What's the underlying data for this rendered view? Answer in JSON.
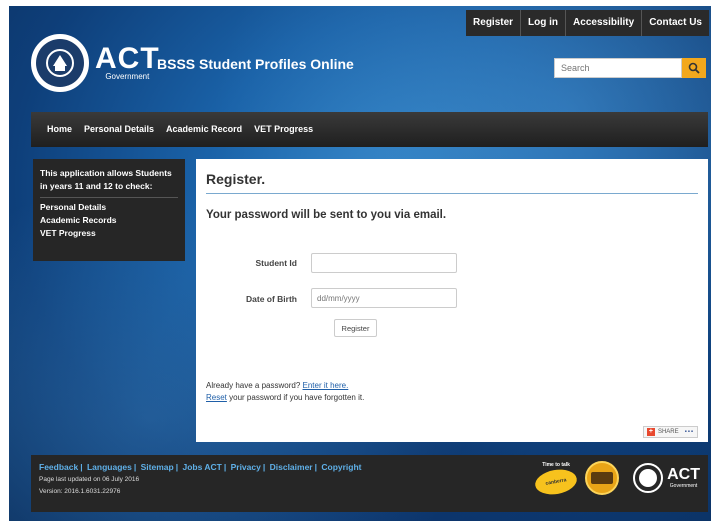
{
  "topnav": {
    "items": [
      "Register",
      "Log in",
      "Accessibility",
      "Contact Us"
    ]
  },
  "logo": {
    "name": "ACT",
    "sub": "Government"
  },
  "site": {
    "title": "BSSS Student Profiles Online"
  },
  "search": {
    "placeholder": "Search",
    "icon": "search-icon"
  },
  "mainnav": {
    "items": [
      "Home",
      "Personal Details",
      "Academic Record",
      "VET Progress"
    ]
  },
  "sidebar": {
    "intro": "This application allows Students in years 11 and 12 to check:",
    "links": [
      "Personal Details",
      "Academic Records",
      "VET Progress"
    ]
  },
  "content": {
    "title": "Register.",
    "subtitle": "Your password will be sent to you via email.",
    "student_id_label": "Student Id",
    "student_id_value": "",
    "dob_label": "Date of Birth",
    "dob_placeholder": "dd/mm/yyyy",
    "register_button": "Register",
    "already_text": "Already have a password? ",
    "enter_link": "Enter it here.",
    "reset_link": "Reset",
    "reset_text": " your password if you have forgotten it.",
    "share_label": "SHARE"
  },
  "footer": {
    "links": [
      "Feedback",
      "Languages",
      "Sitemap",
      "Jobs ACT",
      "Privacy",
      "Disclaimer",
      "Copyright"
    ],
    "updated": "Page last updated on 06 July 2016",
    "version": "Version: 2016.1.6031.22976",
    "time_to_talk": "Time to talk",
    "time_to_talk_badge": "canberra",
    "footer_logo": "ACT",
    "footer_logo_sub": "Government"
  },
  "colors": {
    "accent": "#f2a81d",
    "link": "#1f5fa8",
    "footer_link": "#5fb0e8",
    "nav_bg": "#262626"
  }
}
